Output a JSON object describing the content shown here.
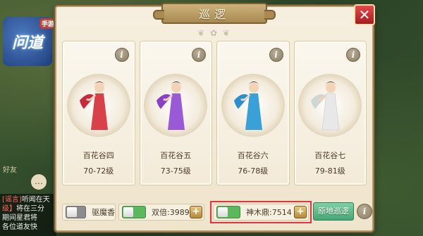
{
  "dialog": {
    "title": "巡逻",
    "close_label": "✕"
  },
  "cards": [
    {
      "name": "百花谷四",
      "level": "70-72级",
      "info_label": "i",
      "dress_color": "#d8404a",
      "ribbon_color": "#c8283a"
    },
    {
      "name": "百花谷五",
      "level": "73-75级",
      "info_label": "i",
      "dress_color": "#9a5ad8",
      "ribbon_color": "#8a3fc8"
    },
    {
      "name": "百花谷六",
      "level": "76-78级",
      "info_label": "i",
      "dress_color": "#3aa0d8",
      "ribbon_color": "#2a8ed0"
    },
    {
      "name": "百花谷七",
      "level": "79-81级",
      "info_label": "i",
      "dress_color": "#e8e8e8",
      "ribbon_color": "#cfd6d6"
    }
  ],
  "options": {
    "incense": {
      "label": "驱魔香",
      "state": "off"
    },
    "double": {
      "label": "双倍:3989",
      "state": "on",
      "plus_label": "+"
    },
    "cauldron": {
      "label": "神木鼎:7514",
      "state": "on",
      "plus_label": "+"
    }
  },
  "patrol_button": {
    "label": "原地巡逻"
  },
  "bottom_info_label": "i",
  "background": {
    "logo_text": "问道",
    "logo_tag": "手游",
    "friend_label": "好友",
    "chat_icon": "…",
    "chat_lines": [
      {
        "tag": "[谣言]",
        "text": "听闻在天"
      },
      {
        "tag": "级】",
        "text": "将在三分"
      },
      {
        "tag": "",
        "text": "期间星君将"
      },
      {
        "tag": "",
        "text": "各位道友快"
      }
    ]
  }
}
